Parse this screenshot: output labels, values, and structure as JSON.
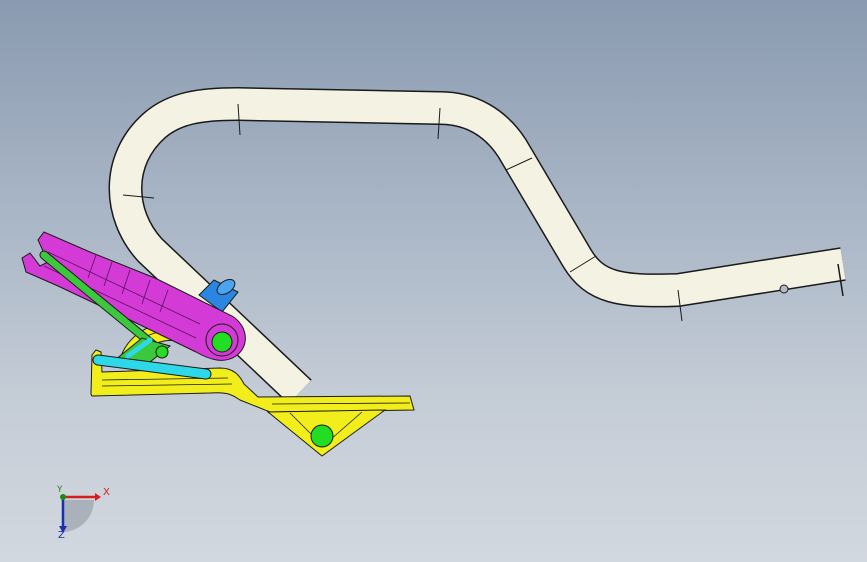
{
  "viewport": {
    "background_top": "#8a9ab0",
    "background_bottom": "#d2d8df"
  },
  "model": {
    "tube_color": "#f4f3e3",
    "lever_color": "#d43ad6",
    "bracket_color": "#f2ee1c",
    "rod_green_color": "#3cc83c",
    "rod_cyan_color": "#2ed8e8",
    "knob_color": "#2a86e0",
    "pin_color": "#22dd22",
    "edge_color": "#1a1a1a"
  },
  "triad": {
    "x_label": "X",
    "y_label": "Y",
    "z_label": "Z",
    "x_color": "#d61e1e",
    "y_color": "#1a8a1a",
    "z_color": "#1a2fb0"
  }
}
